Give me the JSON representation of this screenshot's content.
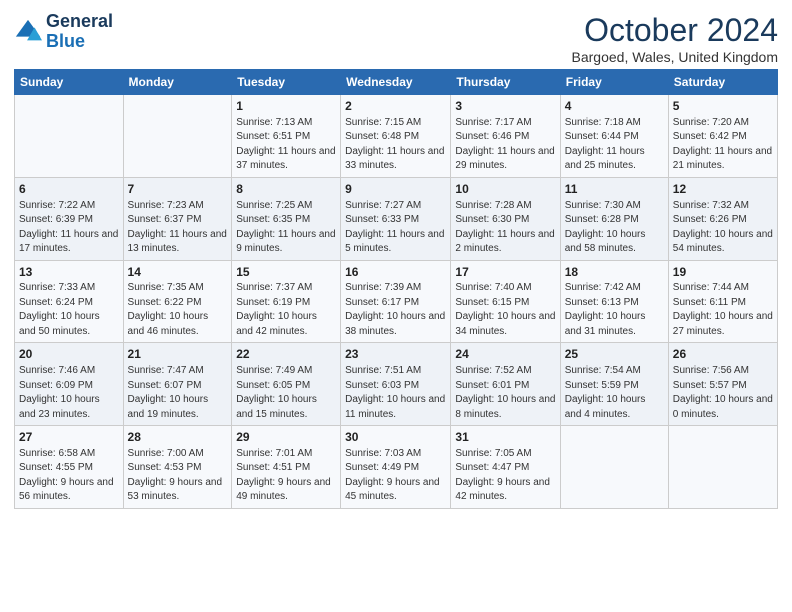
{
  "logo": {
    "line1": "General",
    "line2": "Blue"
  },
  "title": "October 2024",
  "subtitle": "Bargoed, Wales, United Kingdom",
  "headers": [
    "Sunday",
    "Monday",
    "Tuesday",
    "Wednesday",
    "Thursday",
    "Friday",
    "Saturday"
  ],
  "weeks": [
    [
      {
        "day": "",
        "info": ""
      },
      {
        "day": "",
        "info": ""
      },
      {
        "day": "1",
        "info": "Sunrise: 7:13 AM\nSunset: 6:51 PM\nDaylight: 11 hours and 37 minutes."
      },
      {
        "day": "2",
        "info": "Sunrise: 7:15 AM\nSunset: 6:48 PM\nDaylight: 11 hours and 33 minutes."
      },
      {
        "day": "3",
        "info": "Sunrise: 7:17 AM\nSunset: 6:46 PM\nDaylight: 11 hours and 29 minutes."
      },
      {
        "day": "4",
        "info": "Sunrise: 7:18 AM\nSunset: 6:44 PM\nDaylight: 11 hours and 25 minutes."
      },
      {
        "day": "5",
        "info": "Sunrise: 7:20 AM\nSunset: 6:42 PM\nDaylight: 11 hours and 21 minutes."
      }
    ],
    [
      {
        "day": "6",
        "info": "Sunrise: 7:22 AM\nSunset: 6:39 PM\nDaylight: 11 hours and 17 minutes."
      },
      {
        "day": "7",
        "info": "Sunrise: 7:23 AM\nSunset: 6:37 PM\nDaylight: 11 hours and 13 minutes."
      },
      {
        "day": "8",
        "info": "Sunrise: 7:25 AM\nSunset: 6:35 PM\nDaylight: 11 hours and 9 minutes."
      },
      {
        "day": "9",
        "info": "Sunrise: 7:27 AM\nSunset: 6:33 PM\nDaylight: 11 hours and 5 minutes."
      },
      {
        "day": "10",
        "info": "Sunrise: 7:28 AM\nSunset: 6:30 PM\nDaylight: 11 hours and 2 minutes."
      },
      {
        "day": "11",
        "info": "Sunrise: 7:30 AM\nSunset: 6:28 PM\nDaylight: 10 hours and 58 minutes."
      },
      {
        "day": "12",
        "info": "Sunrise: 7:32 AM\nSunset: 6:26 PM\nDaylight: 10 hours and 54 minutes."
      }
    ],
    [
      {
        "day": "13",
        "info": "Sunrise: 7:33 AM\nSunset: 6:24 PM\nDaylight: 10 hours and 50 minutes."
      },
      {
        "day": "14",
        "info": "Sunrise: 7:35 AM\nSunset: 6:22 PM\nDaylight: 10 hours and 46 minutes."
      },
      {
        "day": "15",
        "info": "Sunrise: 7:37 AM\nSunset: 6:19 PM\nDaylight: 10 hours and 42 minutes."
      },
      {
        "day": "16",
        "info": "Sunrise: 7:39 AM\nSunset: 6:17 PM\nDaylight: 10 hours and 38 minutes."
      },
      {
        "day": "17",
        "info": "Sunrise: 7:40 AM\nSunset: 6:15 PM\nDaylight: 10 hours and 34 minutes."
      },
      {
        "day": "18",
        "info": "Sunrise: 7:42 AM\nSunset: 6:13 PM\nDaylight: 10 hours and 31 minutes."
      },
      {
        "day": "19",
        "info": "Sunrise: 7:44 AM\nSunset: 6:11 PM\nDaylight: 10 hours and 27 minutes."
      }
    ],
    [
      {
        "day": "20",
        "info": "Sunrise: 7:46 AM\nSunset: 6:09 PM\nDaylight: 10 hours and 23 minutes."
      },
      {
        "day": "21",
        "info": "Sunrise: 7:47 AM\nSunset: 6:07 PM\nDaylight: 10 hours and 19 minutes."
      },
      {
        "day": "22",
        "info": "Sunrise: 7:49 AM\nSunset: 6:05 PM\nDaylight: 10 hours and 15 minutes."
      },
      {
        "day": "23",
        "info": "Sunrise: 7:51 AM\nSunset: 6:03 PM\nDaylight: 10 hours and 11 minutes."
      },
      {
        "day": "24",
        "info": "Sunrise: 7:52 AM\nSunset: 6:01 PM\nDaylight: 10 hours and 8 minutes."
      },
      {
        "day": "25",
        "info": "Sunrise: 7:54 AM\nSunset: 5:59 PM\nDaylight: 10 hours and 4 minutes."
      },
      {
        "day": "26",
        "info": "Sunrise: 7:56 AM\nSunset: 5:57 PM\nDaylight: 10 hours and 0 minutes."
      }
    ],
    [
      {
        "day": "27",
        "info": "Sunrise: 6:58 AM\nSunset: 4:55 PM\nDaylight: 9 hours and 56 minutes."
      },
      {
        "day": "28",
        "info": "Sunrise: 7:00 AM\nSunset: 4:53 PM\nDaylight: 9 hours and 53 minutes."
      },
      {
        "day": "29",
        "info": "Sunrise: 7:01 AM\nSunset: 4:51 PM\nDaylight: 9 hours and 49 minutes."
      },
      {
        "day": "30",
        "info": "Sunrise: 7:03 AM\nSunset: 4:49 PM\nDaylight: 9 hours and 45 minutes."
      },
      {
        "day": "31",
        "info": "Sunrise: 7:05 AM\nSunset: 4:47 PM\nDaylight: 9 hours and 42 minutes."
      },
      {
        "day": "",
        "info": ""
      },
      {
        "day": "",
        "info": ""
      }
    ]
  ]
}
